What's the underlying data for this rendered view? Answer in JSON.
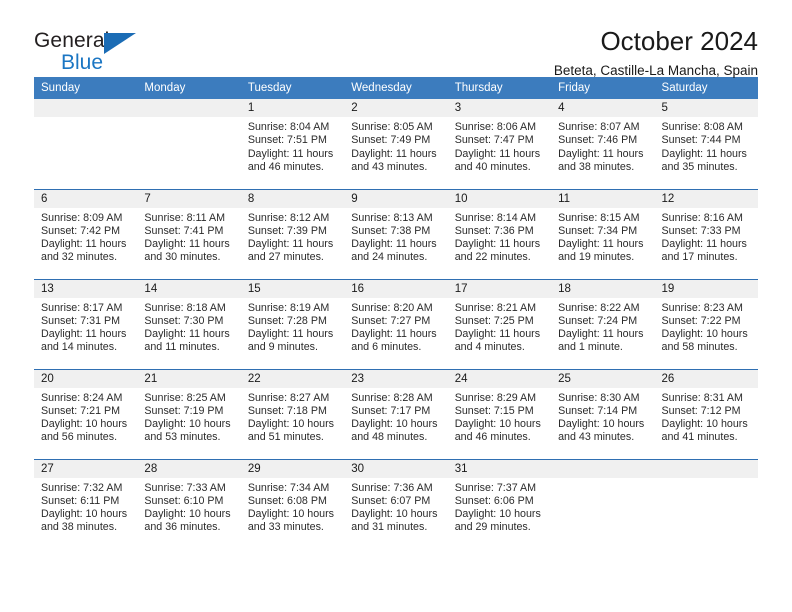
{
  "brand": {
    "line1": "General",
    "line2": "Blue",
    "flag_icon": "triangle-flag-icon",
    "accent_color": "#1b6cb5"
  },
  "header": {
    "title": "October 2024",
    "subtitle": "Beteta, Castille-La Mancha, Spain"
  },
  "theme": {
    "header_blue": "#3c7cbe",
    "rule_blue": "#2f6fb2",
    "daynum_band": "#f0f0f0",
    "text": "#1a1a1a"
  },
  "labels": {
    "sunrise_prefix": "Sunrise:",
    "sunset_prefix": "Sunset:",
    "daylight_prefix": "Daylight:"
  },
  "weekdays": [
    "Sunday",
    "Monday",
    "Tuesday",
    "Wednesday",
    "Thursday",
    "Friday",
    "Saturday"
  ],
  "weeks": [
    [
      {
        "day": "",
        "empty": true
      },
      {
        "day": "",
        "empty": true
      },
      {
        "day": "1",
        "sunrise": "Sunrise: 8:04 AM",
        "sunset": "Sunset: 7:51 PM",
        "daylight": "Daylight: 11 hours and 46 minutes."
      },
      {
        "day": "2",
        "sunrise": "Sunrise: 8:05 AM",
        "sunset": "Sunset: 7:49 PM",
        "daylight": "Daylight: 11 hours and 43 minutes."
      },
      {
        "day": "3",
        "sunrise": "Sunrise: 8:06 AM",
        "sunset": "Sunset: 7:47 PM",
        "daylight": "Daylight: 11 hours and 40 minutes."
      },
      {
        "day": "4",
        "sunrise": "Sunrise: 8:07 AM",
        "sunset": "Sunset: 7:46 PM",
        "daylight": "Daylight: 11 hours and 38 minutes."
      },
      {
        "day": "5",
        "sunrise": "Sunrise: 8:08 AM",
        "sunset": "Sunset: 7:44 PM",
        "daylight": "Daylight: 11 hours and 35 minutes."
      }
    ],
    [
      {
        "day": "6",
        "sunrise": "Sunrise: 8:09 AM",
        "sunset": "Sunset: 7:42 PM",
        "daylight": "Daylight: 11 hours and 32 minutes."
      },
      {
        "day": "7",
        "sunrise": "Sunrise: 8:11 AM",
        "sunset": "Sunset: 7:41 PM",
        "daylight": "Daylight: 11 hours and 30 minutes."
      },
      {
        "day": "8",
        "sunrise": "Sunrise: 8:12 AM",
        "sunset": "Sunset: 7:39 PM",
        "daylight": "Daylight: 11 hours and 27 minutes."
      },
      {
        "day": "9",
        "sunrise": "Sunrise: 8:13 AM",
        "sunset": "Sunset: 7:38 PM",
        "daylight": "Daylight: 11 hours and 24 minutes."
      },
      {
        "day": "10",
        "sunrise": "Sunrise: 8:14 AM",
        "sunset": "Sunset: 7:36 PM",
        "daylight": "Daylight: 11 hours and 22 minutes."
      },
      {
        "day": "11",
        "sunrise": "Sunrise: 8:15 AM",
        "sunset": "Sunset: 7:34 PM",
        "daylight": "Daylight: 11 hours and 19 minutes."
      },
      {
        "day": "12",
        "sunrise": "Sunrise: 8:16 AM",
        "sunset": "Sunset: 7:33 PM",
        "daylight": "Daylight: 11 hours and 17 minutes."
      }
    ],
    [
      {
        "day": "13",
        "sunrise": "Sunrise: 8:17 AM",
        "sunset": "Sunset: 7:31 PM",
        "daylight": "Daylight: 11 hours and 14 minutes."
      },
      {
        "day": "14",
        "sunrise": "Sunrise: 8:18 AM",
        "sunset": "Sunset: 7:30 PM",
        "daylight": "Daylight: 11 hours and 11 minutes."
      },
      {
        "day": "15",
        "sunrise": "Sunrise: 8:19 AM",
        "sunset": "Sunset: 7:28 PM",
        "daylight": "Daylight: 11 hours and 9 minutes."
      },
      {
        "day": "16",
        "sunrise": "Sunrise: 8:20 AM",
        "sunset": "Sunset: 7:27 PM",
        "daylight": "Daylight: 11 hours and 6 minutes."
      },
      {
        "day": "17",
        "sunrise": "Sunrise: 8:21 AM",
        "sunset": "Sunset: 7:25 PM",
        "daylight": "Daylight: 11 hours and 4 minutes."
      },
      {
        "day": "18",
        "sunrise": "Sunrise: 8:22 AM",
        "sunset": "Sunset: 7:24 PM",
        "daylight": "Daylight: 11 hours and 1 minute."
      },
      {
        "day": "19",
        "sunrise": "Sunrise: 8:23 AM",
        "sunset": "Sunset: 7:22 PM",
        "daylight": "Daylight: 10 hours and 58 minutes."
      }
    ],
    [
      {
        "day": "20",
        "sunrise": "Sunrise: 8:24 AM",
        "sunset": "Sunset: 7:21 PM",
        "daylight": "Daylight: 10 hours and 56 minutes."
      },
      {
        "day": "21",
        "sunrise": "Sunrise: 8:25 AM",
        "sunset": "Sunset: 7:19 PM",
        "daylight": "Daylight: 10 hours and 53 minutes."
      },
      {
        "day": "22",
        "sunrise": "Sunrise: 8:27 AM",
        "sunset": "Sunset: 7:18 PM",
        "daylight": "Daylight: 10 hours and 51 minutes."
      },
      {
        "day": "23",
        "sunrise": "Sunrise: 8:28 AM",
        "sunset": "Sunset: 7:17 PM",
        "daylight": "Daylight: 10 hours and 48 minutes."
      },
      {
        "day": "24",
        "sunrise": "Sunrise: 8:29 AM",
        "sunset": "Sunset: 7:15 PM",
        "daylight": "Daylight: 10 hours and 46 minutes."
      },
      {
        "day": "25",
        "sunrise": "Sunrise: 8:30 AM",
        "sunset": "Sunset: 7:14 PM",
        "daylight": "Daylight: 10 hours and 43 minutes."
      },
      {
        "day": "26",
        "sunrise": "Sunrise: 8:31 AM",
        "sunset": "Sunset: 7:12 PM",
        "daylight": "Daylight: 10 hours and 41 minutes."
      }
    ],
    [
      {
        "day": "27",
        "sunrise": "Sunrise: 7:32 AM",
        "sunset": "Sunset: 6:11 PM",
        "daylight": "Daylight: 10 hours and 38 minutes."
      },
      {
        "day": "28",
        "sunrise": "Sunrise: 7:33 AM",
        "sunset": "Sunset: 6:10 PM",
        "daylight": "Daylight: 10 hours and 36 minutes."
      },
      {
        "day": "29",
        "sunrise": "Sunrise: 7:34 AM",
        "sunset": "Sunset: 6:08 PM",
        "daylight": "Daylight: 10 hours and 33 minutes."
      },
      {
        "day": "30",
        "sunrise": "Sunrise: 7:36 AM",
        "sunset": "Sunset: 6:07 PM",
        "daylight": "Daylight: 10 hours and 31 minutes."
      },
      {
        "day": "31",
        "sunrise": "Sunrise: 7:37 AM",
        "sunset": "Sunset: 6:06 PM",
        "daylight": "Daylight: 10 hours and 29 minutes."
      },
      {
        "day": "",
        "empty": true
      },
      {
        "day": "",
        "empty": true
      }
    ]
  ]
}
